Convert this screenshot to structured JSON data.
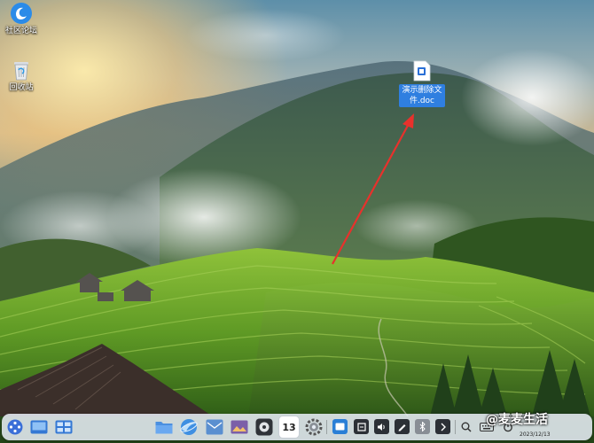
{
  "desktop": {
    "icons": [
      {
        "label": "社区论坛",
        "icon": "forum-app-icon"
      },
      {
        "label": "回收站",
        "icon": "trash-icon"
      }
    ],
    "file": {
      "label_line1": "演示删除文",
      "label_line2": "件.doc",
      "icon": "doc-file-icon"
    }
  },
  "taskbar": {
    "calendar_day": "13",
    "date": "2023/12/13",
    "watermark": "@麦麦生活",
    "launcher_icon": "launcher-icon"
  },
  "colors": {
    "file_label_bg": "#2f7fe0",
    "arrow": "#e8312c",
    "taskbar_bg": "#e6ecf4"
  }
}
